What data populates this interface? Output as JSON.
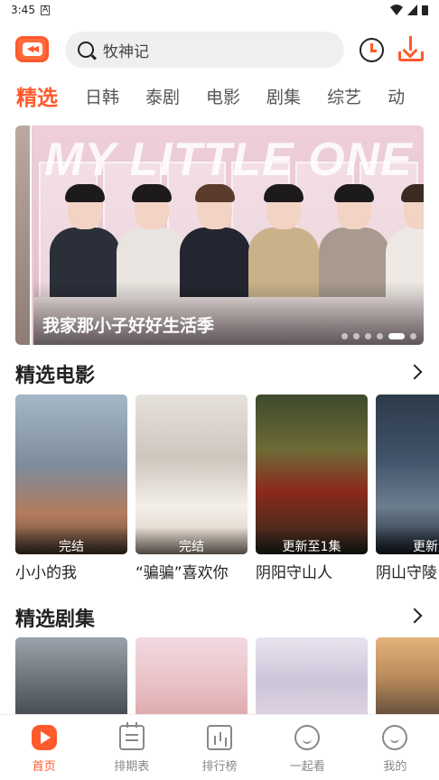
{
  "status_bar": {
    "time": "3:45",
    "indicator": "A"
  },
  "header": {
    "search_placeholder": "牧神记",
    "icons": [
      "logo-icon",
      "search-icon",
      "history-clock-icon",
      "download-icon"
    ]
  },
  "tabs": [
    "精选",
    "日韩",
    "泰剧",
    "电影",
    "剧集",
    "综艺",
    "动"
  ],
  "banner": {
    "caption": "我家那小子好好生活季",
    "background_text": "MY LITTLE ONE",
    "dots_total": 6,
    "dots_active_index": 4
  },
  "sections": {
    "movies": {
      "title": "精选电影",
      "items": [
        {
          "title": "小小的我",
          "status": "完结"
        },
        {
          "title": "“骗骗”喜欢你",
          "status": "完结"
        },
        {
          "title": "阴阳守山人",
          "status": "更新至1集"
        },
        {
          "title": "阴山守陵",
          "status": "更新至"
        }
      ]
    },
    "series": {
      "title": "精选剧集"
    }
  },
  "tabbar": [
    {
      "label": "首页",
      "icon": "home-play-icon",
      "active": true
    },
    {
      "label": "排期表",
      "icon": "calendar-icon",
      "active": false
    },
    {
      "label": "排行榜",
      "icon": "chart-icon",
      "active": false
    },
    {
      "label": "一起看",
      "icon": "watch-together-icon",
      "active": false
    },
    {
      "label": "我的",
      "icon": "profile-icon",
      "active": false
    }
  ],
  "colors": {
    "accent": "#ff5a2c",
    "inactive": "#888888"
  }
}
